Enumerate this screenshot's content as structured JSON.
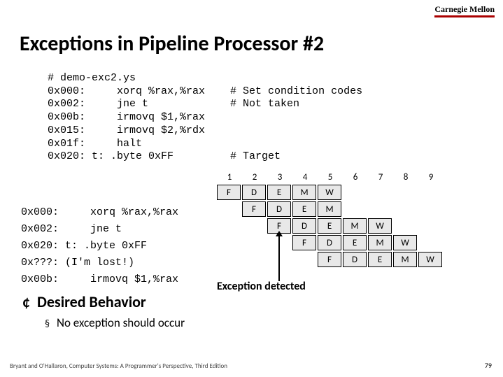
{
  "brand": "Carnegie Mellon",
  "title": "Exceptions in Pipeline Processor #2",
  "code": {
    "l0": "# demo-exc2.ys",
    "l1": "0x000:     xorq %rax,%rax    # Set condition codes",
    "l2": "0x002:     jne t             # Not taken",
    "l3": "0x00b:     irmovq $1,%rax",
    "l4": "0x015:     irmovq $2,%rdx",
    "l5": "0x01f:     halt",
    "l6": "0x020: t: .byte 0xFF         # Target"
  },
  "cycles": [
    "1",
    "2",
    "3",
    "4",
    "5",
    "6",
    "7",
    "8",
    "9"
  ],
  "trace": {
    "r0": "0x000:     xorq %rax,%rax",
    "r1": "0x002:     jne t",
    "r2": "0x020: t: .byte 0xFF",
    "r3": "0x???: (I'm lost!)",
    "r4": "0x00b:     irmovq $1,%rax"
  },
  "stages": {
    "F": "F",
    "D": "D",
    "E": "E",
    "M": "M",
    "W": "W"
  },
  "exc_label": "Exception detected",
  "behavior_heading": "Desired Behavior",
  "behavior_item": "No exception should occur",
  "footer_left": "Bryant and O'Hallaron, Computer Systems: A Programmer's Perspective, Third Edition",
  "footer_right": "79"
}
